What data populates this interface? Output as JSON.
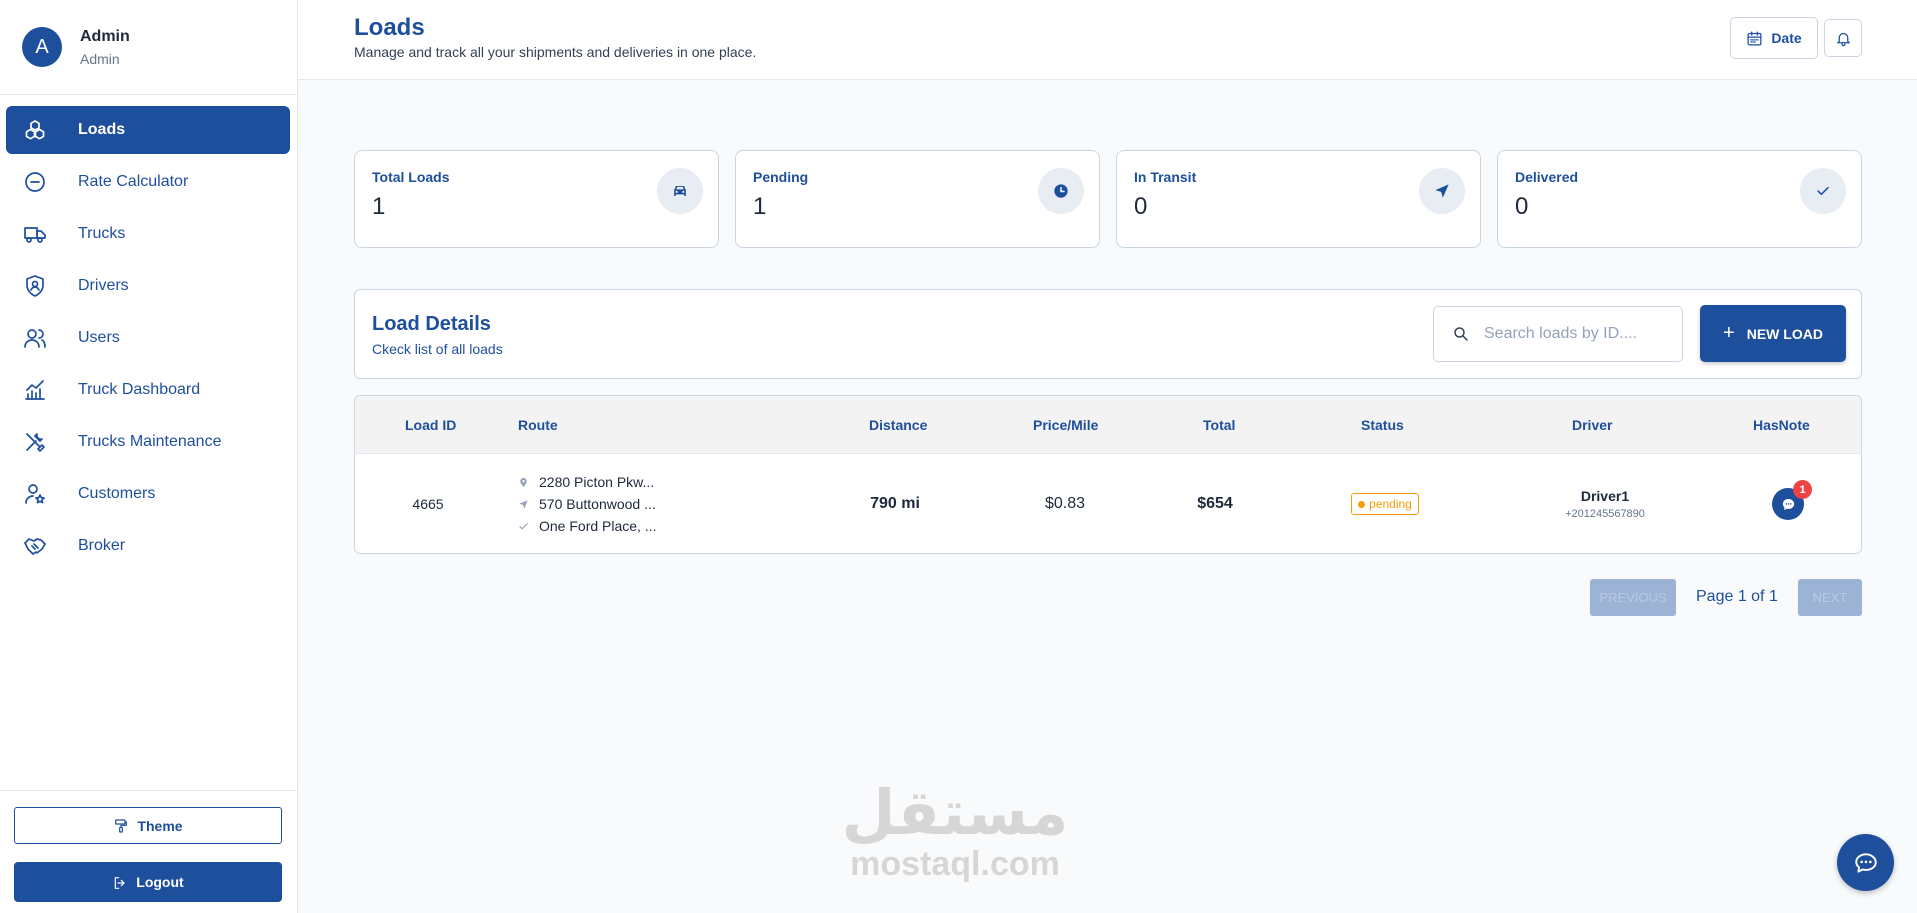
{
  "user": {
    "avatar_letter": "A",
    "name": "Admin",
    "role": "Admin"
  },
  "sidebar": {
    "items": [
      {
        "label": "Loads",
        "icon": "boxes-icon",
        "active": true
      },
      {
        "label": "Rate Calculator",
        "icon": "minus-circle-icon",
        "active": false
      },
      {
        "label": "Trucks",
        "icon": "truck-icon",
        "active": false
      },
      {
        "label": "Drivers",
        "icon": "shield-user-icon",
        "active": false
      },
      {
        "label": "Users",
        "icon": "users-icon",
        "active": false
      },
      {
        "label": "Truck Dashboard",
        "icon": "chart-icon",
        "active": false
      },
      {
        "label": "Trucks Maintenance",
        "icon": "tools-icon",
        "active": false
      },
      {
        "label": "Customers",
        "icon": "user-star-icon",
        "active": false
      },
      {
        "label": "Broker",
        "icon": "handshake-icon",
        "active": false
      }
    ],
    "theme_label": "Theme",
    "logout_label": "Logout"
  },
  "header": {
    "title": "Loads",
    "subtitle": "Manage and track all your shipments and deliveries in one place.",
    "date_label": "Date"
  },
  "stats": [
    {
      "label": "Total Loads",
      "value": "1",
      "icon": "car-icon"
    },
    {
      "label": "Pending",
      "value": "1",
      "icon": "clock-icon"
    },
    {
      "label": "In Transit",
      "value": "0",
      "icon": "navigation-icon"
    },
    {
      "label": "Delivered",
      "value": "0",
      "icon": "check-icon"
    }
  ],
  "details": {
    "title": "Load Details",
    "subtitle": "Ckeck list of all loads",
    "search_placeholder": "Search loads by ID....",
    "new_load_label": "NEW LOAD"
  },
  "table": {
    "columns": [
      "Load ID",
      "Route",
      "Distance",
      "Price/Mile",
      "Total",
      "Status",
      "Driver",
      "HasNote"
    ],
    "rows": [
      {
        "load_id": "4665",
        "route": [
          "2280 Picton Pkw...",
          "570 Buttonwood ...",
          "One Ford Place, ..."
        ],
        "distance": "790 mi",
        "price_mile": "$0.83",
        "total": "$654",
        "status": "pending",
        "driver_name": "Driver1",
        "driver_phone": "+201245567890",
        "note_count": "1"
      }
    ]
  },
  "pagination": {
    "previous": "PREVIOUS",
    "page_info": "Page 1 of 1",
    "next": "NEXT"
  },
  "watermark": {
    "arabic": "مستقل",
    "latin": "mostaql.com"
  },
  "colors": {
    "primary": "#1e4f9c",
    "pending": "#f59e0b",
    "badge": "#ef4444"
  }
}
